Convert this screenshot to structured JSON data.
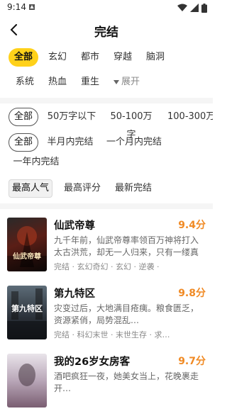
{
  "status": {
    "time": "9:14"
  },
  "header": {
    "title": "完结"
  },
  "category_filter": {
    "items": [
      "全部",
      "玄幻",
      "都市",
      "穿越",
      "脑洞",
      "系统",
      "热血",
      "重生"
    ],
    "expand_label": "展开"
  },
  "word_filter": {
    "items": [
      "全部",
      "50万字以下",
      "50-100万字",
      "100-300万"
    ]
  },
  "time_filter": {
    "items": [
      "全部",
      "半月内完结",
      "一个月内完结",
      "一年内完结"
    ]
  },
  "sort_filter": {
    "items": [
      "最高人气",
      "最高评分",
      "最新完结"
    ]
  },
  "books": [
    {
      "name": "仙武帝尊",
      "score": "9.4分",
      "desc": "九千年前，仙武帝尊率领百万神将打入太古洪荒，却无一人归来，只有一缕真火遗留世…",
      "tags": "完结 · 玄幻奇幻 · 玄幻 · 逆袭 ·",
      "cover_text": "仙武帝尊"
    },
    {
      "name": "第九特区",
      "score": "9.8分",
      "desc": "灾变过后，大地满目疮痍。粮食匮乏，资源紧俏，局势混乱…",
      "tags": "完结 · 科幻末世 · 末世生存 · 求…",
      "cover_text": "第九特区"
    },
    {
      "name": "我的26岁女房客",
      "score": "9.7分",
      "desc": "酒吧疯狂一夜，她美女当上，花晚裹走开…",
      "tags": "",
      "cover_text": ""
    }
  ]
}
